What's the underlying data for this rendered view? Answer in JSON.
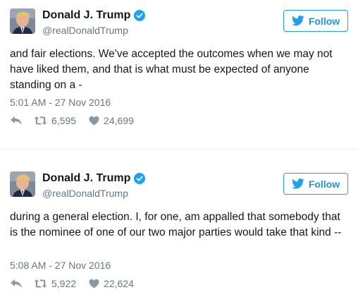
{
  "tweets": [
    {
      "name": "Donald J. Trump",
      "handle": "@realDonaldTrump",
      "follow_label": "Follow",
      "text": "and fair elections. We've accepted the outcomes when we may not have liked them, and that is what must be expected of anyone standing on a -",
      "timestamp": "5:01 AM - 27 Nov 2016",
      "retweets": "6,595",
      "likes": "24,699"
    },
    {
      "name": "Donald J. Trump",
      "handle": "@realDonaldTrump",
      "follow_label": "Follow",
      "text": "during a general election. I, for one, am appalled that somebody that is the nominee of one of our two major parties would take that kind --",
      "timestamp": "5:08 AM - 27 Nov 2016",
      "retweets": "5,922",
      "likes": "22,624"
    }
  ],
  "colors": {
    "accent": "#1da1f2",
    "secondary_text": "#657786",
    "primary_text": "#14171a"
  },
  "icons": [
    "verified-badge-icon",
    "twitter-bird-icon",
    "reply-icon",
    "retweet-icon",
    "heart-icon"
  ]
}
